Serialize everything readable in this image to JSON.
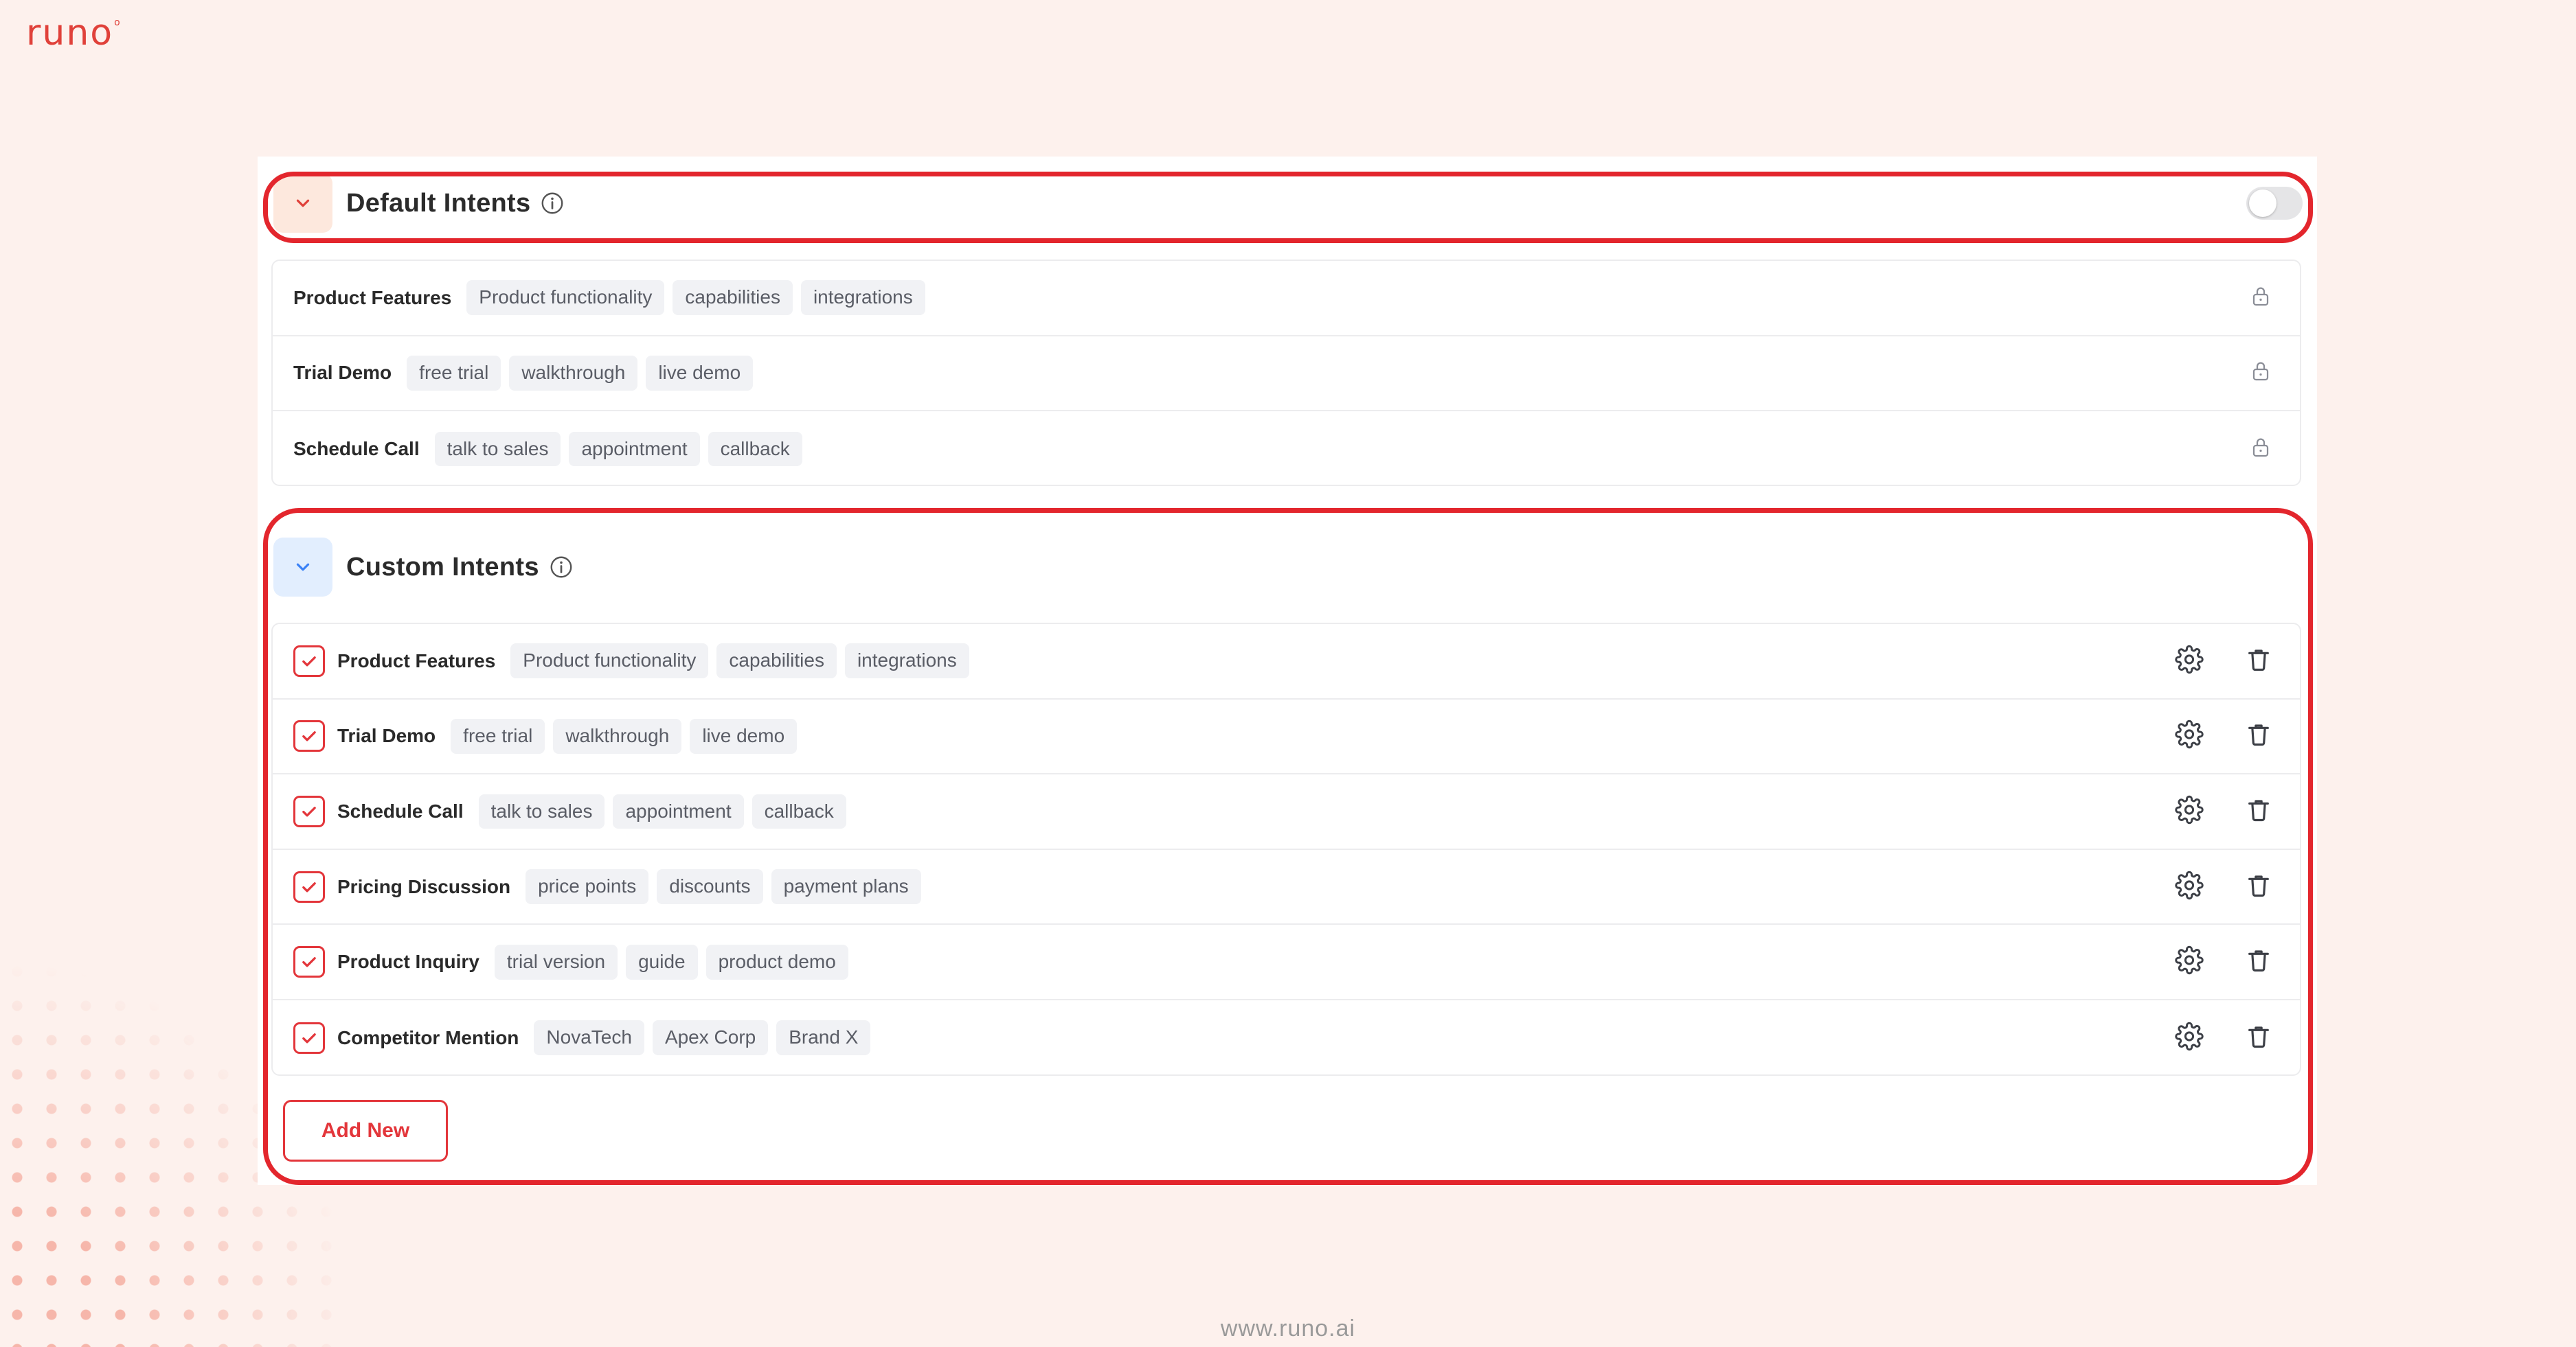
{
  "brand": {
    "logo_text": "runo"
  },
  "footer": {
    "url": "www.runo.ai"
  },
  "colors": {
    "accent": "#e3262d",
    "background": "#fdf1ed",
    "tag_bg": "#f1f2f5"
  },
  "default_intents": {
    "title": "Default Intents",
    "toggle_on": false,
    "items": [
      {
        "name": "Product Features",
        "tags": [
          "Product functionality",
          "capabilities",
          "integrations"
        ],
        "icon": "lock-icon"
      },
      {
        "name": "Trial Demo",
        "tags": [
          "free trial",
          "walkthrough",
          "live demo"
        ],
        "icon": "lock-icon"
      },
      {
        "name": "Schedule Call",
        "tags": [
          "talk to sales",
          "appointment",
          "callback"
        ],
        "icon": "lock-icon"
      }
    ]
  },
  "custom_intents": {
    "title": "Custom Intents",
    "items": [
      {
        "name": "Product Features",
        "checked": true,
        "tags": [
          "Product functionality",
          "capabilities",
          "integrations"
        ]
      },
      {
        "name": "Trial Demo",
        "checked": true,
        "tags": [
          "free trial",
          "walkthrough",
          "live demo"
        ]
      },
      {
        "name": "Schedule Call",
        "checked": true,
        "tags": [
          "talk to sales",
          "appointment",
          "callback"
        ]
      },
      {
        "name": "Pricing Discussion",
        "checked": true,
        "tags": [
          "price points",
          "discounts",
          "payment plans"
        ]
      },
      {
        "name": "Product Inquiry",
        "checked": true,
        "tags": [
          "trial version",
          "guide",
          "product demo"
        ]
      },
      {
        "name": "Competitor Mention",
        "checked": true,
        "tags": [
          "NovaTech",
          "Apex Corp",
          "Brand X"
        ]
      }
    ],
    "add_button_label": "Add New"
  }
}
